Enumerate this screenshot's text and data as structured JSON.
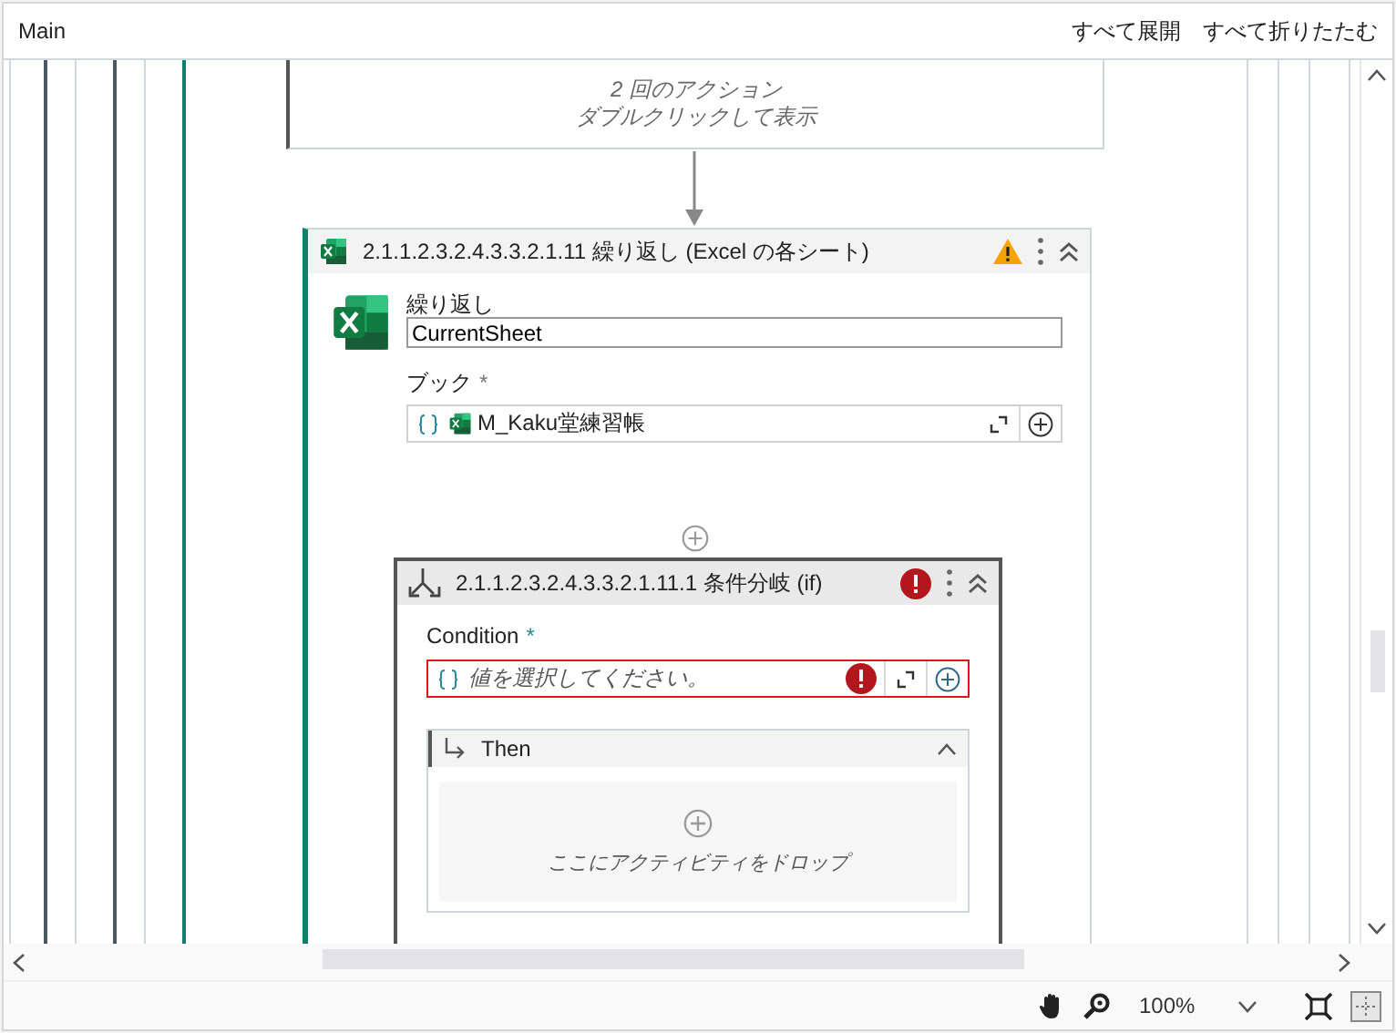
{
  "tab": {
    "title": "Main"
  },
  "header_actions": [
    {
      "label": "すべて展開"
    },
    {
      "label": "すべて折りたたむ"
    }
  ],
  "collapsed_block": {
    "lines": [
      "2 回のアクション",
      "ダブルクリックして表示"
    ]
  },
  "loop_activity": {
    "title": "2.1.1.2.3.2.4.3.3.2.1.11 繰り返し (Excel の各シート)",
    "has_warning": true,
    "expanded": true,
    "loop_label": "繰り返し",
    "loop_value": "CurrentSheet",
    "book_label": "ブック",
    "book_required_mark": "*",
    "book_value": "M_Kaku堂練習帳"
  },
  "if_activity": {
    "title": "2.1.1.2.3.2.4.3.3.2.1.11.1 条件分岐 (if)",
    "has_error": true,
    "expanded": true,
    "condition_label": "Condition",
    "condition_required_mark": "*",
    "condition_placeholder": "値を選択してください。",
    "condition_invalid": true,
    "then": {
      "label": "Then",
      "expanded": true,
      "drop_hint": "ここにアクティビティをドロップ"
    }
  },
  "status_bar": {
    "zoom": "100%"
  }
}
